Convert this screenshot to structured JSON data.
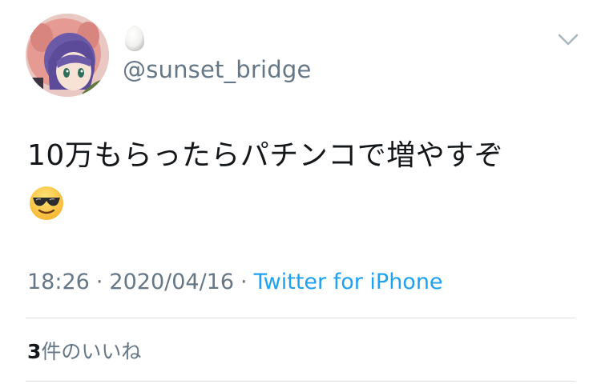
{
  "tweet": {
    "display_name_icon": "egg-emoji",
    "handle": "@sunset_bridge",
    "text": "10万もらったらパチンコで増やすぞ",
    "emoji": "smiling-face-with-sunglasses",
    "time": "18:26",
    "separator": "·",
    "date": "2020/04/16",
    "source": "Twitter for iPhone",
    "likes_count": "3",
    "likes_label": "件のいいね"
  },
  "colors": {
    "handle_gray": "#657786",
    "link_blue": "#1da1f2",
    "text": "#14171a",
    "divider": "#d8dde1"
  }
}
